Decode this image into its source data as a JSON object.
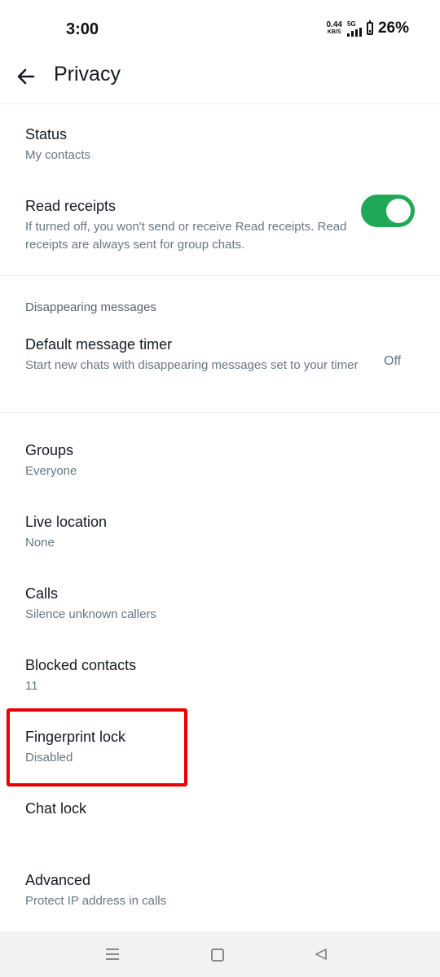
{
  "status_bar": {
    "time": "3:00",
    "net_speed": "0.44",
    "net_unit": "KB/S",
    "network": "5G",
    "battery": "26%"
  },
  "header": {
    "title": "Privacy",
    "back_icon": "arrow-left-icon"
  },
  "items": [
    {
      "label": "Status",
      "sub": "My contacts"
    },
    {
      "label": "Read receipts",
      "sub": "If turned off, you won't send or receive Read receipts. Read receipts are always sent for group chats.",
      "toggle_on": true
    },
    {
      "label": "Default message timer",
      "sub": "Start new chats with disappearing messages set to your timer",
      "value": "Off"
    },
    {
      "label": "Groups",
      "sub": "Everyone"
    },
    {
      "label": "Live location",
      "sub": "None"
    },
    {
      "label": "Calls",
      "sub": "Silence unknown callers"
    },
    {
      "label": "Blocked contacts",
      "sub": "11"
    },
    {
      "label": "Fingerprint lock",
      "sub": "Disabled"
    },
    {
      "label": "Chat lock"
    },
    {
      "label": "Advanced",
      "sub": "Protect IP address in calls"
    }
  ],
  "section": {
    "disappearing": "Disappearing messages"
  },
  "colors": {
    "toggle_on": "#1fa855",
    "highlight": "#ef0000",
    "secondary_text": "#667781"
  },
  "nav": {
    "menu_icon": "menu-icon",
    "home_icon": "home-icon",
    "back_icon": "back-triangle-icon"
  }
}
